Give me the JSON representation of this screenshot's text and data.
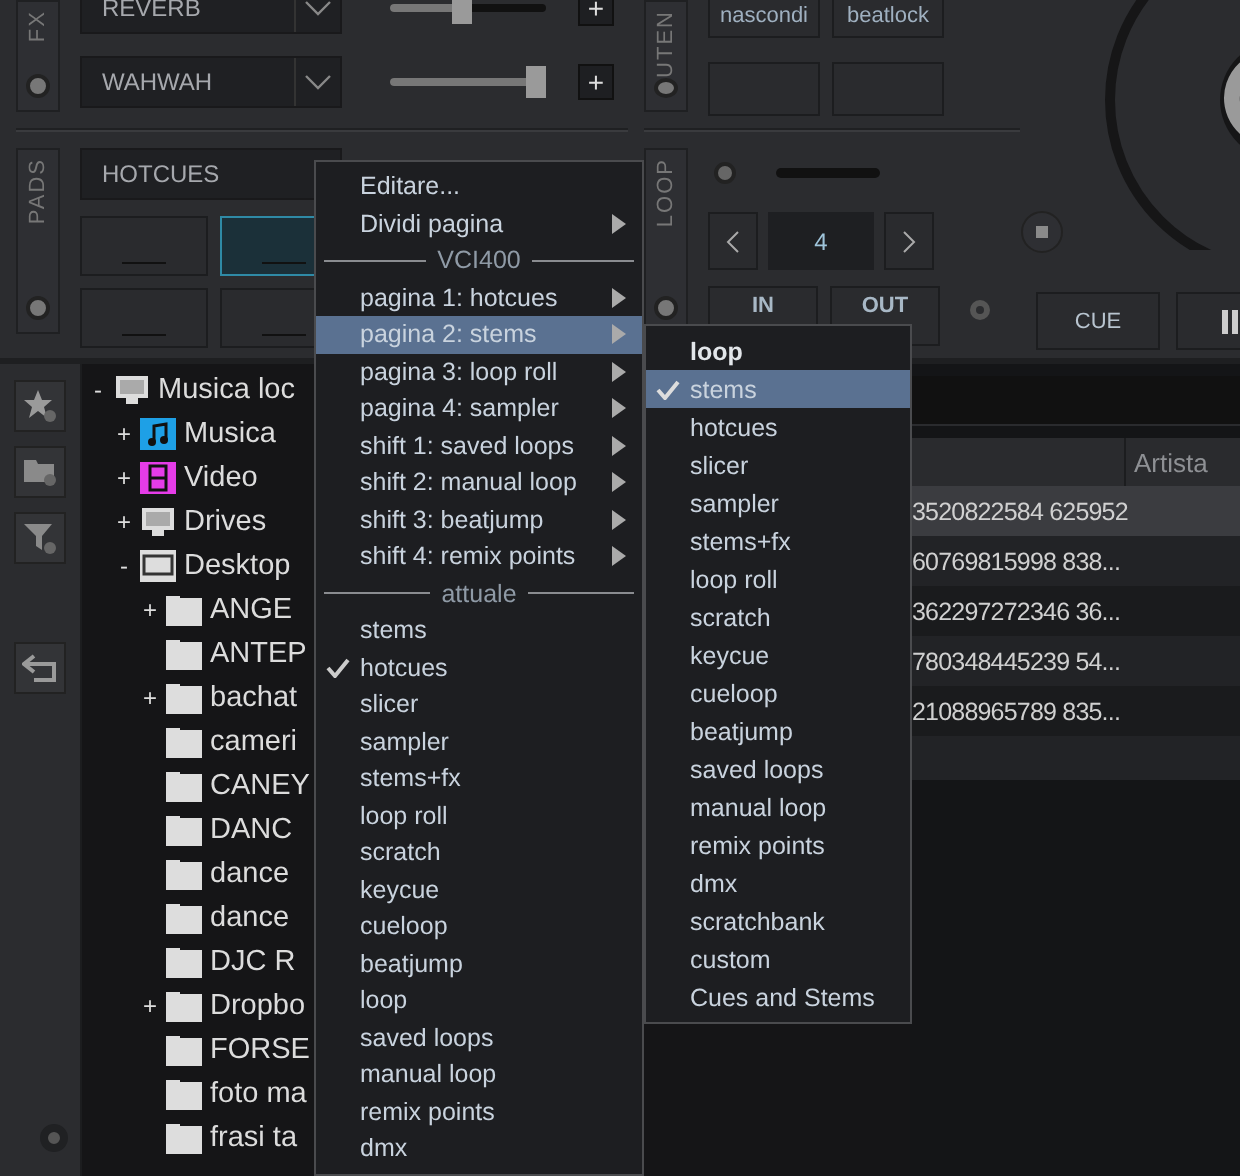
{
  "fx_panel": {
    "label": "FX",
    "effects": [
      {
        "name": "REVERB",
        "level": 0.45,
        "add_label": "+"
      },
      {
        "name": "WAHWAH",
        "level": 1,
        "add_label": "+"
      }
    ]
  },
  "user_panel": {
    "label": "UTEN",
    "buttons": [
      "nascondi",
      "beatlock"
    ]
  },
  "pads_panel": {
    "label": "PADS",
    "mode": "HOTCUES",
    "pads": [
      {
        "on": false
      },
      {
        "on": true
      },
      {
        "on": false
      },
      {
        "on": false
      }
    ]
  },
  "loop_panel": {
    "label": "LOOP",
    "size": "4",
    "buttons": [
      "IN",
      "OUT"
    ]
  },
  "transport": {
    "cue_label": "CUE"
  },
  "browser": {
    "tree": [
      {
        "label": "Musica loc",
        "kind": "computer",
        "expander": "-",
        "children": [
          {
            "label": "Musica",
            "kind": "music",
            "expander": "+"
          },
          {
            "label": "Video",
            "kind": "video",
            "expander": "+"
          },
          {
            "label": "Drives",
            "kind": "computer",
            "expander": "+"
          },
          {
            "label": "Desktop",
            "kind": "desktop",
            "expander": "-",
            "children": [
              {
                "label": "ANGE",
                "kind": "folder",
                "expander": "+"
              },
              {
                "label": "ANTEP",
                "kind": "folder"
              },
              {
                "label": "bachat",
                "kind": "folder",
                "expander": "+"
              },
              {
                "label": "cameri",
                "kind": "folder"
              },
              {
                "label": "CANEY",
                "kind": "folder"
              },
              {
                "label": "DANC",
                "kind": "folder"
              },
              {
                "label": "dance",
                "kind": "folder"
              },
              {
                "label": "dance",
                "kind": "folder"
              },
              {
                "label": "DJC R",
                "kind": "folder"
              },
              {
                "label": "Dropbo",
                "kind": "folder",
                "expander": "+"
              },
              {
                "label": "FORSE",
                "kind": "folder"
              },
              {
                "label": "foto ma",
                "kind": "folder"
              },
              {
                "label": "frasi ta",
                "kind": "folder"
              }
            ]
          }
        ]
      }
    ],
    "list": {
      "columns": [
        "Artista"
      ],
      "rows": [
        {
          "column_1": "3520822584 625952",
          "selected": true
        },
        {
          "column_1": "60769815998 838...",
          "selected": false
        },
        {
          "column_1": "362297272346 36...",
          "selected": false
        },
        {
          "column_1": "780348445239 54...",
          "selected": false
        },
        {
          "column_1": "21088965789 835...",
          "selected": false
        }
      ]
    }
  },
  "menu": {
    "items": [
      {
        "label": "Editare...",
        "kind": "item",
        "selected": false,
        "checked": false
      },
      {
        "label": "Dividi pagina",
        "kind": "submenu",
        "selected": false,
        "checked": false
      },
      {
        "label": "VCI400",
        "kind": "header"
      },
      {
        "label": "pagina 1: hotcues",
        "kind": "submenu",
        "selected": false,
        "checked": false
      },
      {
        "label": "pagina 2: stems",
        "kind": "submenu",
        "selected": true,
        "checked": false
      },
      {
        "label": "pagina 3: loop roll",
        "kind": "submenu",
        "selected": false,
        "checked": false
      },
      {
        "label": "pagina 4: sampler",
        "kind": "submenu",
        "selected": false,
        "checked": false
      },
      {
        "label": "shift 1: saved loops",
        "kind": "submenu",
        "selected": false,
        "checked": false
      },
      {
        "label": "shift 2: manual loop",
        "kind": "submenu",
        "selected": false,
        "checked": false
      },
      {
        "label": "shift 3: beatjump",
        "kind": "submenu",
        "selected": false,
        "checked": false
      },
      {
        "label": "shift 4: remix points",
        "kind": "submenu",
        "selected": false,
        "checked": false
      },
      {
        "label": "attuale",
        "kind": "header"
      },
      {
        "label": "stems",
        "kind": "item",
        "selected": false,
        "checked": false
      },
      {
        "label": "hotcues",
        "kind": "item",
        "selected": false,
        "checked": true
      },
      {
        "label": "slicer",
        "kind": "item",
        "selected": false,
        "checked": false
      },
      {
        "label": "sampler",
        "kind": "item",
        "selected": false,
        "checked": false
      },
      {
        "label": "stems+fx",
        "kind": "item",
        "selected": false,
        "checked": false
      },
      {
        "label": "loop roll",
        "kind": "item",
        "selected": false,
        "checked": false
      },
      {
        "label": "scratch",
        "kind": "item",
        "selected": false,
        "checked": false
      },
      {
        "label": "keycue",
        "kind": "item",
        "selected": false,
        "checked": false
      },
      {
        "label": "cueloop",
        "kind": "item",
        "selected": false,
        "checked": false
      },
      {
        "label": "beatjump",
        "kind": "item",
        "selected": false,
        "checked": false
      },
      {
        "label": "loop",
        "kind": "item",
        "selected": false,
        "checked": false
      },
      {
        "label": "saved loops",
        "kind": "item",
        "selected": false,
        "checked": false
      },
      {
        "label": "manual loop",
        "kind": "item",
        "selected": false,
        "checked": false
      },
      {
        "label": "remix points",
        "kind": "item",
        "selected": false,
        "checked": false
      },
      {
        "label": "dmx",
        "kind": "item",
        "selected": false,
        "checked": false
      }
    ]
  },
  "submenu": {
    "title": "loop",
    "items": [
      {
        "label": "stems",
        "selected": true,
        "checked": true
      },
      {
        "label": "hotcues",
        "selected": false,
        "checked": false
      },
      {
        "label": "slicer",
        "selected": false,
        "checked": false
      },
      {
        "label": "sampler",
        "selected": false,
        "checked": false
      },
      {
        "label": "stems+fx",
        "selected": false,
        "checked": false
      },
      {
        "label": "loop roll",
        "selected": false,
        "checked": false
      },
      {
        "label": "scratch",
        "selected": false,
        "checked": false
      },
      {
        "label": "keycue",
        "selected": false,
        "checked": false
      },
      {
        "label": "cueloop",
        "selected": false,
        "checked": false
      },
      {
        "label": "beatjump",
        "selected": false,
        "checked": false
      },
      {
        "label": "saved loops",
        "selected": false,
        "checked": false
      },
      {
        "label": "manual loop",
        "selected": false,
        "checked": false
      },
      {
        "label": "remix points",
        "selected": false,
        "checked": false
      },
      {
        "label": "dmx",
        "selected": false,
        "checked": false
      },
      {
        "label": "scratchbank",
        "selected": false,
        "checked": false
      },
      {
        "label": "custom",
        "selected": false,
        "checked": false
      },
      {
        "label": "Cues and Stems",
        "selected": false,
        "checked": false
      }
    ]
  }
}
